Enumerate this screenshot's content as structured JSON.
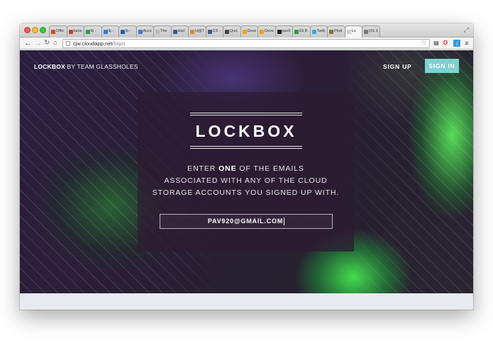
{
  "browser": {
    "tabs": [
      {
        "label": "Offic",
        "icon": "office-icon",
        "color": "#cc4a1a"
      },
      {
        "label": "bans",
        "icon": "gmail-icon",
        "color": "#d23f31"
      },
      {
        "label": "lb -",
        "icon": "drive-icon",
        "color": "#2d9c4f"
      },
      {
        "label": "lb -",
        "icon": "dropbox-icon",
        "color": "#2d7de0"
      },
      {
        "label": "lb -",
        "icon": "onedrive-icon",
        "color": "#1c5fb8"
      },
      {
        "label": "Acco",
        "icon": "cloud-icon",
        "color": "#3b7fd1"
      },
      {
        "label": "The",
        "icon": "page-icon",
        "color": "#bbbbbb"
      },
      {
        "label": "Harl",
        "icon": "facebook-icon",
        "color": "#3b5998"
      },
      {
        "label": "H@T",
        "icon": "hat-icon",
        "color": "#e08a1e"
      },
      {
        "label": "CS -",
        "icon": "cs-icon",
        "color": "#3d5a8f"
      },
      {
        "label": "Quic",
        "icon": "phone-icon",
        "color": "#444444"
      },
      {
        "label": "Deve",
        "icon": "dev-icon",
        "color": "#f2a20c"
      },
      {
        "label": "Deve",
        "icon": "dev-icon",
        "color": "#f2a20c"
      },
      {
        "label": "pav9",
        "icon": "github-icon",
        "color": "#222222"
      },
      {
        "label": "Eli B",
        "icon": "b-icon",
        "color": "#2c9d3d"
      },
      {
        "label": "Twitt",
        "icon": "twitter-icon",
        "color": "#33a9e6"
      },
      {
        "label": "Phot",
        "icon": "brush-icon",
        "color": "#8a6d3b"
      },
      {
        "label": "Lo",
        "icon": "page-icon",
        "color": "#cccccc",
        "active": true
      },
      {
        "label": "OS X",
        "icon": "apple-icon",
        "color": "#777777"
      }
    ],
    "url_host": "cjw.cloudapp.net",
    "url_path": "/login"
  },
  "header": {
    "brand_name": "LOCKBOX",
    "brand_sub": " BY TEAM GLASSHOLES",
    "signup_label": "SIGN UP",
    "signin_label": "SIGN IN"
  },
  "panel": {
    "logo": "LOCKBOX",
    "instruction_pre": "ENTER ",
    "instruction_emph": "ONE",
    "instruction_post": " OF THE EMAILS",
    "instruction_line2": "ASSOCIATED WITH ANY OF THE CLOUD",
    "instruction_line3": "STORAGE ACCOUNTS YOU SIGNED UP WITH.",
    "email_value": "PAV920@GMAIL.COM"
  },
  "colors": {
    "accent": "#7ed2d0",
    "panel_bg": "#2d1c32",
    "aurora_green": "#46e650"
  }
}
